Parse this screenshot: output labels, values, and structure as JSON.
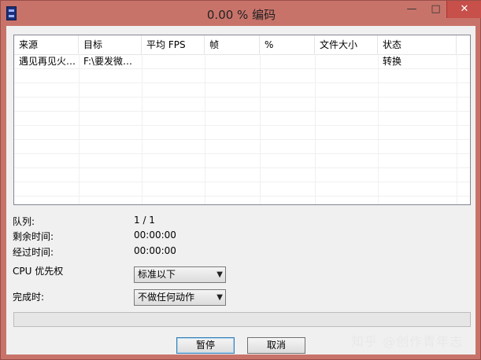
{
  "window": {
    "title": "0.00 % 编码",
    "min": "—",
    "max": "□",
    "close": "✕"
  },
  "table": {
    "columns": [
      "来源",
      "目标",
      "平均 FPS",
      "帧",
      "%",
      "文件大小",
      "状态"
    ],
    "rows": [
      [
        "遇见再见火…",
        "F:\\要发微…",
        "",
        "",
        "",
        "",
        "转换"
      ]
    ]
  },
  "info": {
    "queue_label": "队列:",
    "queue_value": "1 / 1",
    "remaining_label": "剩余时间:",
    "remaining_value": "00:00:00",
    "elapsed_label": "经过时间:",
    "elapsed_value": "00:00:00",
    "cpu_label": "CPU 优先权",
    "cpu_value": "标准以下",
    "done_label": "完成时:",
    "done_value": "不做任何动作"
  },
  "progress": {
    "value": 0
  },
  "buttons": {
    "pause": "暂停",
    "cancel": "取消"
  },
  "watermark": "知乎 @创作青年志",
  "colors": {
    "frame": "#c8736a",
    "close": "#c7504a",
    "progress_fill": "#06b025"
  }
}
